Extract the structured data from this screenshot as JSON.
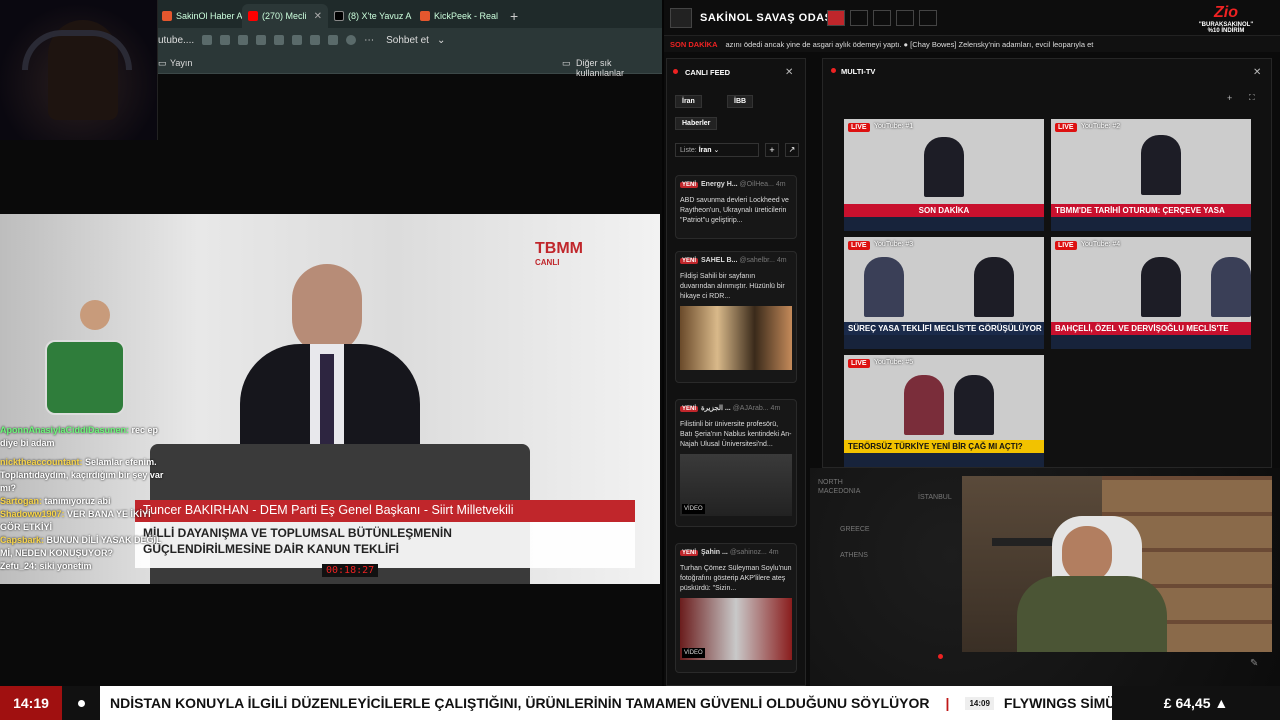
{
  "browser": {
    "tabs": [
      {
        "label": "SakinOl Haber A",
        "color": "#e4572e"
      },
      {
        "label": "(270) Mecli",
        "color": "#ff0000"
      },
      {
        "label": "(8) X'te Yavuz A",
        "color": "#000000"
      },
      {
        "label": "KickPeek - Real",
        "color": "#e4572e"
      }
    ],
    "address": "utube....",
    "chat_button": "Sohbet et",
    "bookmark_left": "Yayın",
    "bookmark_right": "Diğer sık kullanılanlar"
  },
  "video": {
    "channel_logo": "TBMM",
    "channel_sub": "CANLI",
    "name_strip": "Tuncer BAKIRHAN - DEM Parti Eş Genel Başkanı - Siirt Milletvekili",
    "topic_line1": "MİLLİ DAYANIŞMA VE TOPLUMSAL BÜTÜNLEŞMENİN",
    "topic_line2": "GÜÇLENDİRİLMESİNE DAİR KANUN TEKLİFİ",
    "timer": "00:18:27"
  },
  "chat": [
    {
      "user": "AponnAnasiylaCiddiDasunen:",
      "msg": "rec ep diye bi adam",
      "color": "u1"
    },
    {
      "user": "nicktheaccountant:",
      "msg": "Selamlar efenim. Toplantıdaydım, kaçırdığım bir şey var mı?",
      "color": "u2"
    },
    {
      "user": "Sartogan:",
      "msg": "tanımıyoruz abi",
      "color": "u2"
    },
    {
      "user": "Shadoww1907:",
      "msg": "VER BANA YE İKİYİ GÖR ETKİYİ",
      "color": "u2"
    },
    {
      "user": "Capsbark:",
      "msg": "BUNUN DİLİ YASAK DEĞİL Mİ, NEDEN KONUŞUYOR?",
      "color": "u2"
    },
    {
      "user": "Zefu_24:",
      "msg": "siki yonetim",
      "color": "u3"
    }
  ],
  "app": {
    "title": "SAKİNOL SAVAŞ ODASI",
    "brand": "Zio",
    "brand_promo": "\"BURAKSAKINOL\" %10 İNDİRİM",
    "ticker_label": "SON DAKİKA",
    "ticker_text": "azını ödedi ancak yine de asgari aylık ödemeyi yaptı.  ●  [Chay Bowes] Zelensky'nin adamları, evcil leoparıyla et"
  },
  "feed": {
    "title": "CANLI FEED",
    "tabs": [
      "İran",
      "İBB",
      "Haberler"
    ],
    "list_label": "Liste:",
    "list_value": "İran",
    "badge": "YENİ",
    "cards": [
      {
        "source": "Energy H...",
        "handle": "@OilHea...",
        "time": "4m",
        "text": "ABD savunma devleri Lockheed ve Raytheon'un, Ukraynalı üreticilerin \"Patriot\"u geliştirip..."
      },
      {
        "source": "SAHEL B...",
        "handle": "@sahelbr...",
        "time": "4m",
        "text": "Fildişi Sahili bir sayfanın duvarından alınmıştır. Hüzünlü bir hikaye ci RDR..."
      },
      {
        "source": "الجزيرة ...",
        "handle": "@AJArab...",
        "time": "4m",
        "text": "Filistinli bir üniversite profesörü, Batı Şeria'nın Nablus kentindeki An-Najah Ulusal Üniversitesi'nd..."
      },
      {
        "source": "Şahin ...",
        "handle": "@sahinoz...",
        "time": "4m",
        "text": "Turhan Çömez Süleyman Soylu'nun fotoğrafını gösterip AKP'lilere ateş püskürdü: \"Sizin..."
      }
    ],
    "video_label": "VİDEO"
  },
  "multi": {
    "title": "MULTI-TV",
    "tiles": [
      {
        "tag": "LIVE",
        "name": "YouTube: #1",
        "caption": "SON DAKİKA"
      },
      {
        "tag": "LIVE",
        "name": "YouTube: #2",
        "caption": "TBMM'DE TARİHİ OTURUM: ÇERÇEVE YASA"
      },
      {
        "tag": "LIVE",
        "name": "YouTube: #3",
        "caption": "SÜREÇ YASA TEKLİFİ MECLİS'TE GÖRÜŞÜLÜYOR"
      },
      {
        "tag": "LIVE",
        "name": "YouTube: #4",
        "caption": "BAHÇELİ, ÖZEL VE DERVİŞOĞLU MECLİS'TE"
      },
      {
        "tag": "LIVE",
        "name": "YouTube: #5",
        "caption": "TERÖRSÜZ TÜRKİYE YENİ BİR ÇAĞ MI AÇTI?"
      }
    ]
  },
  "map": {
    "labels": [
      "NORTH MACEDONIA",
      "GREECE",
      "ATHENS",
      "İSTANBUL"
    ]
  },
  "bottom": {
    "time": "14:19",
    "ticker": "NDİSTAN KONUYLA İLGİLİ DÜZENLEYİCİLERLE ÇALIŞTIĞINI, ÜRÜNLERİNİN TAMAMEN GÜVENLİ OLDUĞUNU SÖYLÜYOR",
    "ticker_time": "14:09",
    "ticker2": "FLYWINGS SİMÜLATÖR E",
    "price": "£ 64,45 ▲"
  }
}
